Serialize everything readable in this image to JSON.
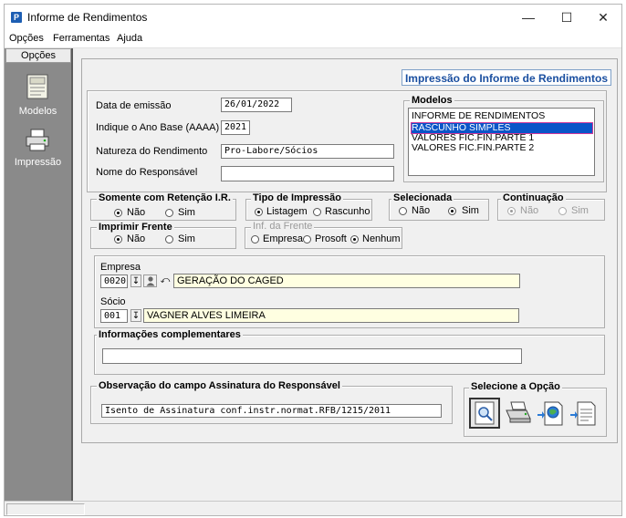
{
  "window": {
    "title": "Informe de Rendimentos",
    "app_icon": "P"
  },
  "menu": [
    "Opções",
    "Ferramentas",
    "Ajuda"
  ],
  "sidebar": {
    "header": "Opções",
    "items": [
      {
        "label": "Modelos",
        "icon": "document-icon"
      },
      {
        "label": "Impressão",
        "icon": "printer-icon"
      }
    ]
  },
  "header_title": "Impressão do Informe de Rendimentos",
  "form": {
    "data_emissao": {
      "label": "Data de emissão",
      "value": "26/01/2022"
    },
    "ano_base": {
      "label": "Indique o Ano Base (AAAA)",
      "value": "2021"
    },
    "natureza": {
      "label": "Natureza do Rendimento",
      "value": "Pro-Labore/Sócios"
    },
    "responsavel": {
      "label": "Nome do Responsável",
      "value": ""
    }
  },
  "modelos": {
    "legend": "Modelos",
    "items": [
      "INFORME DE RENDIMENTOS",
      "RASCUNHO SIMPLES",
      "VALORES FIC.FIN.PARTE 1",
      "VALORES FIC.FIN.PARTE 2"
    ],
    "selected_index": 1
  },
  "retencao": {
    "legend": "Somente com Retenção I.R.",
    "options": [
      "Não",
      "Sim"
    ],
    "selected": "Não"
  },
  "tipo_impressao": {
    "legend": "Tipo de Impressão",
    "options": [
      "Listagem",
      "Rascunho"
    ],
    "selected": "Listagem"
  },
  "selecionada": {
    "legend": "Selecionada",
    "options": [
      "Não",
      "Sim"
    ],
    "selected": "Sim"
  },
  "continuacao": {
    "legend": "Continuação",
    "options": [
      "Não",
      "Sim"
    ],
    "selected": "Não",
    "enabled": false
  },
  "imprimir_frente": {
    "legend": "Imprimir Frente",
    "options": [
      "Não",
      "Sim"
    ],
    "selected": "Não"
  },
  "inf_frente": {
    "legend": "Inf. da Frente",
    "options": [
      "Empresa",
      "Prosoft",
      "Nenhum"
    ],
    "selected": "Nenhum"
  },
  "empresa": {
    "label": "Empresa",
    "code": "0020",
    "name": "GERAÇÃO DO CAGED"
  },
  "socio": {
    "label": "Sócio",
    "code": "001",
    "name": "VAGNER ALVES LIMEIRA"
  },
  "info_complementares": {
    "legend": "Informações complementares",
    "value": ""
  },
  "observacao": {
    "legend": "Observação do campo Assinatura do Responsável",
    "value": "Isento de Assinatura conf.instr.normat.RFB/1215/2011"
  },
  "selecione_opcao": {
    "legend": "Selecione a Opção",
    "buttons": [
      "preview-icon",
      "printer-icon",
      "export-globe-icon",
      "export-document-icon"
    ]
  }
}
